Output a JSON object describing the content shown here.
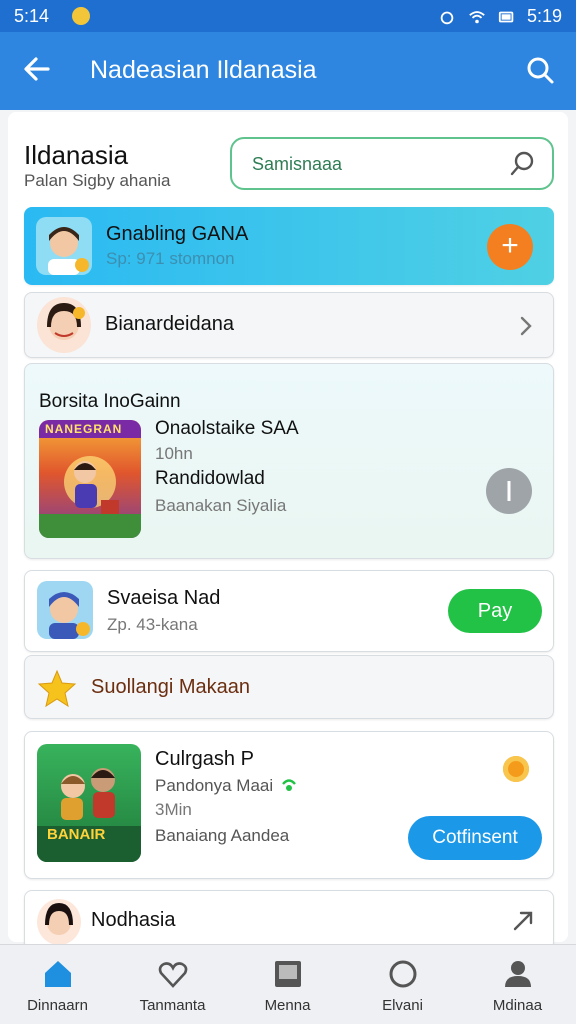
{
  "status_bar": {
    "time_left": "5:14",
    "time_right": "5:19"
  },
  "app_bar": {
    "title": "Nadeasian Ildanasia",
    "back_icon": "back-arrow-icon",
    "search_icon": "search-icon"
  },
  "header": {
    "title": "Ildanasia",
    "subtitle": "Palan Sigby ahania"
  },
  "search": {
    "placeholder": "Samisnaaa"
  },
  "cards": {
    "featured": {
      "title": "Gnabling GANA",
      "subtitle": "Sp: 971 stomnon"
    },
    "profile": {
      "title": "Bianardeidana"
    },
    "game": {
      "section": "Borsita InoGainn",
      "thumb_text": "NANEGRAN",
      "line1": "Onaolstaike SAA",
      "line2": "10hn",
      "line3": "Randidowlad",
      "line4": "Baanakan Siyalia"
    },
    "pay_item": {
      "title": "Svaeisa Nad",
      "subtitle": "Zp. 43-kana",
      "button": "Pay"
    },
    "promo": {
      "title": "Suollangi Makaan"
    },
    "game2": {
      "title": "Culrgash P",
      "line2": "Pandonya Maai",
      "line3": "3Min",
      "line4": "Banaiang Aandea",
      "thumb_text": "BANAIR",
      "button": "Cotfinsent"
    },
    "last": {
      "title": "Nodhasia"
    }
  },
  "bottom_nav": [
    {
      "label": "Dinnaarn",
      "icon": "home-icon"
    },
    {
      "label": "Tanmanta",
      "icon": "heart-icon"
    },
    {
      "label": "Menna",
      "icon": "media-icon"
    },
    {
      "label": "Elvani",
      "icon": "circle-icon"
    },
    {
      "label": "Mdinaa",
      "icon": "profile-icon"
    }
  ],
  "colors": {
    "status_bar": "#1f6fd0",
    "app_bar": "#2e86e0",
    "accent_green": "#21c245",
    "accent_orange": "#f47f20",
    "accent_blue": "#1b98e8"
  }
}
